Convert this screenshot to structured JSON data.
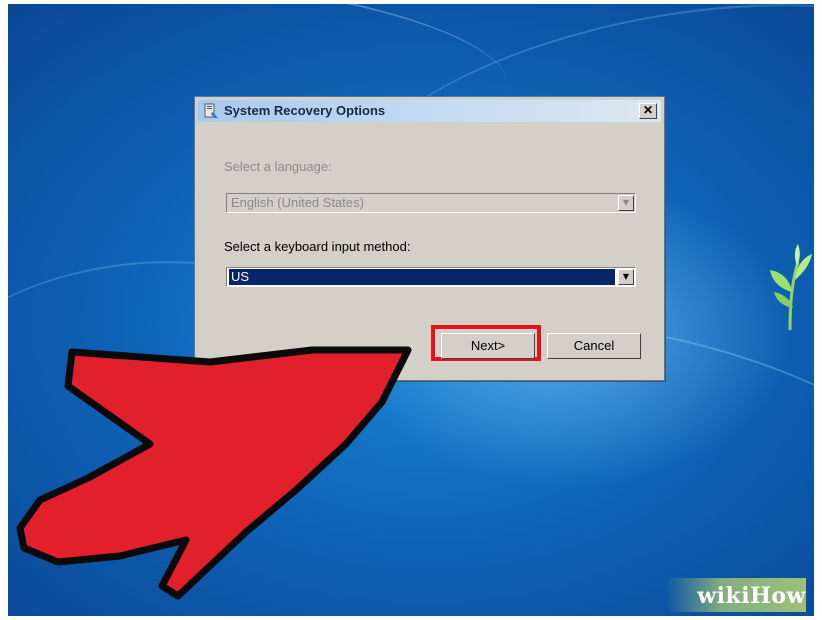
{
  "dialog": {
    "title": "System Recovery Options",
    "close_glyph": "✕",
    "language_label": "Select a language:",
    "language_value": "English (United States)",
    "keyboard_label": "Select a keyboard input method:",
    "keyboard_value": "US",
    "next_label": "Next>",
    "cancel_label": "Cancel",
    "dropdown_glyph": "▼"
  },
  "watermark": {
    "text": "wikiHow"
  },
  "icons": [
    "app-icon",
    "close-icon",
    "chevron-down-icon",
    "pointer-arrow-icon",
    "leaf-icon"
  ],
  "colors": {
    "desktop_blue": "#0e62b6",
    "dialog_face": "#d4d0c8",
    "selection": "#0a246a",
    "highlight_red": "#e8101a",
    "arrow_red": "#e2202c"
  }
}
